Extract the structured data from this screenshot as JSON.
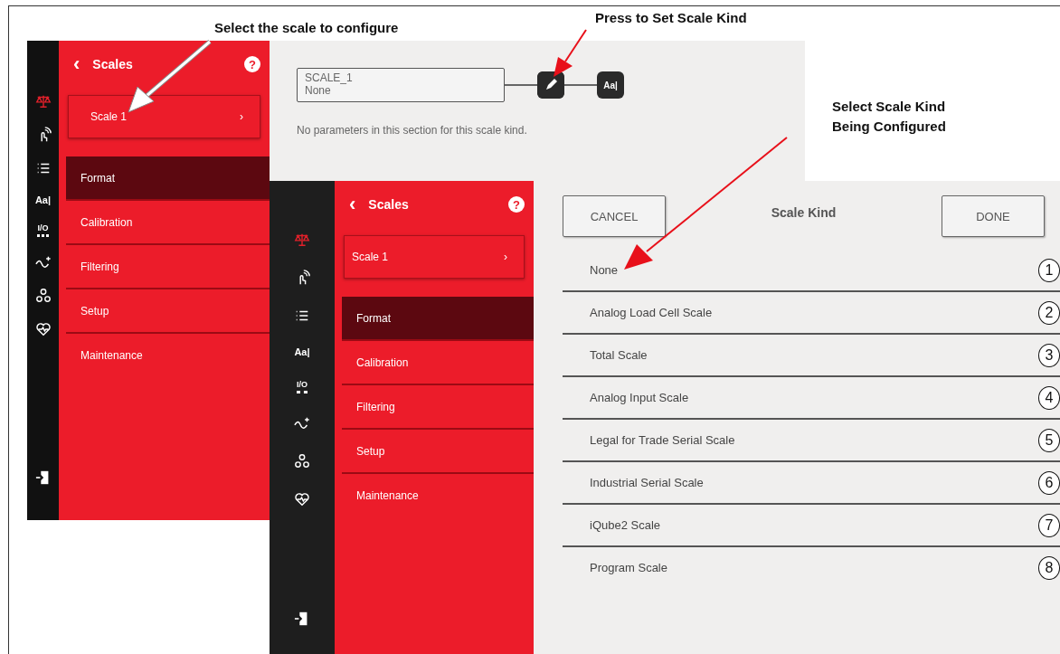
{
  "annotations": [
    {
      "text": "Select the scale to configure"
    },
    {
      "text": "Press to Set Scale Kind"
    },
    {
      "text": "Select Scale Kind Being Configured"
    }
  ],
  "screen_1": {
    "rail": [
      {
        "kind": "scale",
        "selected": true
      },
      {
        "kind": "touch",
        "selected": false
      },
      {
        "kind": "list",
        "selected": false
      },
      {
        "kind": "text",
        "label": "Aa|",
        "selected": false
      },
      {
        "kind": "io",
        "label": "I/O",
        "selected": false
      },
      {
        "kind": "signal",
        "selected": false
      },
      {
        "kind": "network",
        "selected": false
      },
      {
        "kind": "heart",
        "selected": false
      },
      {
        "kind": "exit",
        "selected": false
      }
    ],
    "panel": {
      "back": "‹",
      "title": "Scales",
      "help": "?",
      "scale_selector": {
        "label": "Scale 1",
        "chevron": "›"
      },
      "menu": [
        {
          "label": "Format",
          "selected": true
        },
        {
          "label": "Calibration",
          "selected": false
        },
        {
          "label": "Filtering",
          "selected": false
        },
        {
          "label": "Setup",
          "selected": false
        },
        {
          "label": "Maintenance",
          "selected": false
        }
      ]
    },
    "content": {
      "field": {
        "line_1": "SCALE_1",
        "line_2": "None"
      },
      "aa_button": "Aa|",
      "message": "No parameters in this section for this scale kind."
    }
  },
  "screen_2": {
    "rail": [
      {
        "kind": "scale",
        "selected": true
      },
      {
        "kind": "touch",
        "selected": false
      },
      {
        "kind": "list",
        "selected": false
      },
      {
        "kind": "text",
        "label": "Aa|",
        "selected": false
      },
      {
        "kind": "io",
        "label": "I/O",
        "selected": false
      },
      {
        "kind": "signal",
        "selected": false
      },
      {
        "kind": "network",
        "selected": false
      },
      {
        "kind": "heart",
        "selected": false
      },
      {
        "kind": "exit",
        "selected": false
      }
    ],
    "panel": {
      "back": "‹",
      "title": "Scales",
      "help": "?",
      "scale_selector": {
        "label": "Scale 1",
        "chevron": "›"
      },
      "menu": [
        {
          "label": "Format",
          "selected": true
        },
        {
          "label": "Calibration",
          "selected": false
        },
        {
          "label": "Filtering",
          "selected": false
        },
        {
          "label": "Setup",
          "selected": false
        },
        {
          "label": "Maintenance",
          "selected": false
        }
      ]
    },
    "dialog": {
      "cancel": "CANCEL",
      "title": "Scale Kind",
      "done": "DONE",
      "options": [
        {
          "label": "None",
          "callout": "1"
        },
        {
          "label": "Analog Load Cell Scale",
          "callout": "2"
        },
        {
          "label": "Total Scale",
          "callout": "3"
        },
        {
          "label": "Analog Input Scale",
          "callout": "4"
        },
        {
          "label": "Legal for Trade Serial Scale",
          "callout": "5"
        },
        {
          "label": "Industrial Serial Scale",
          "callout": "6"
        },
        {
          "label": "iQube2 Scale",
          "callout": "7"
        },
        {
          "label": "Program Scale",
          "callout": "8"
        }
      ]
    }
  }
}
